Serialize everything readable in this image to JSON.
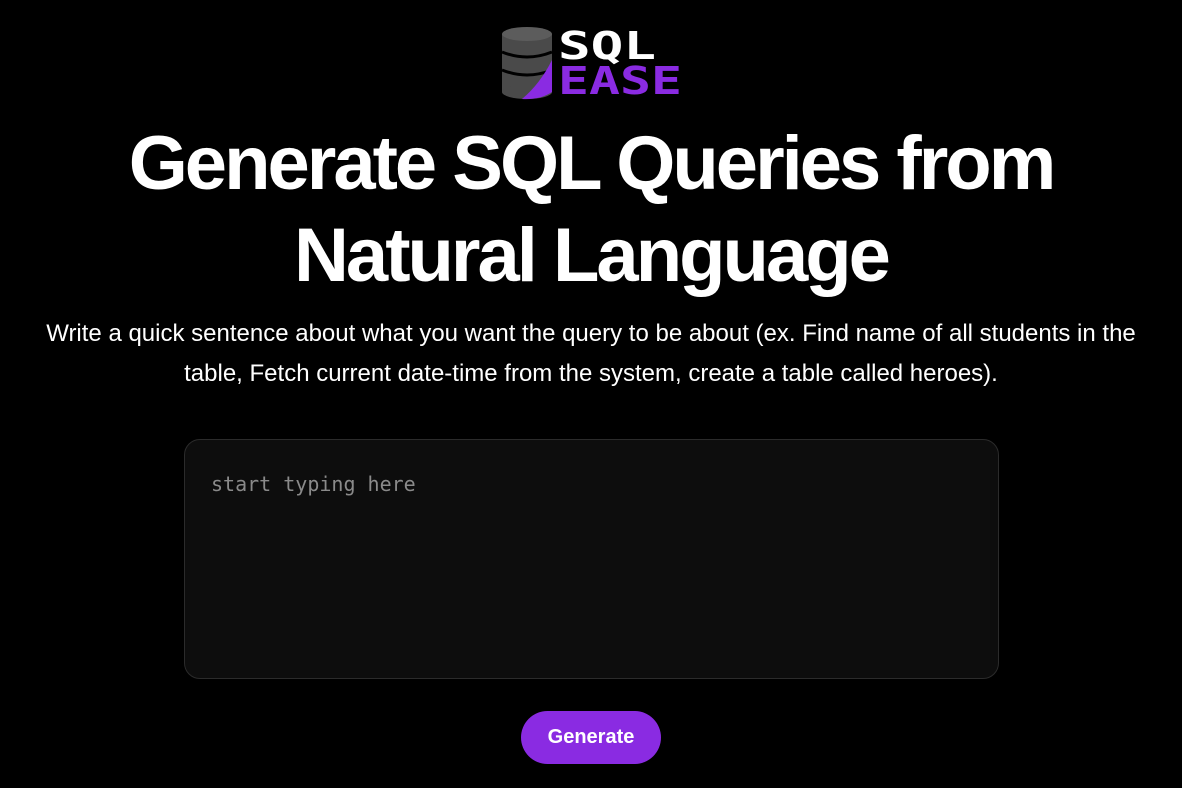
{
  "logo": {
    "line1": "SQL",
    "line2": "EASE",
    "colors": {
      "primary_text": "#ffffff",
      "accent": "#8a2be2",
      "database_icon": "#4a4a4a"
    }
  },
  "hero": {
    "title_line1": "Generate SQL Queries from",
    "title_line2": "Natural Language",
    "description": "Write a quick sentence about what you want the query to be about (ex. Find name of all students in the table, Fetch current date-time from the system, create a table called heroes)."
  },
  "prompt": {
    "value": "",
    "placeholder": "start typing here"
  },
  "actions": {
    "generate_label": "Generate"
  },
  "theme": {
    "background": "#000000",
    "accent": "#8a2be2",
    "input_background": "#0d0d0d"
  }
}
